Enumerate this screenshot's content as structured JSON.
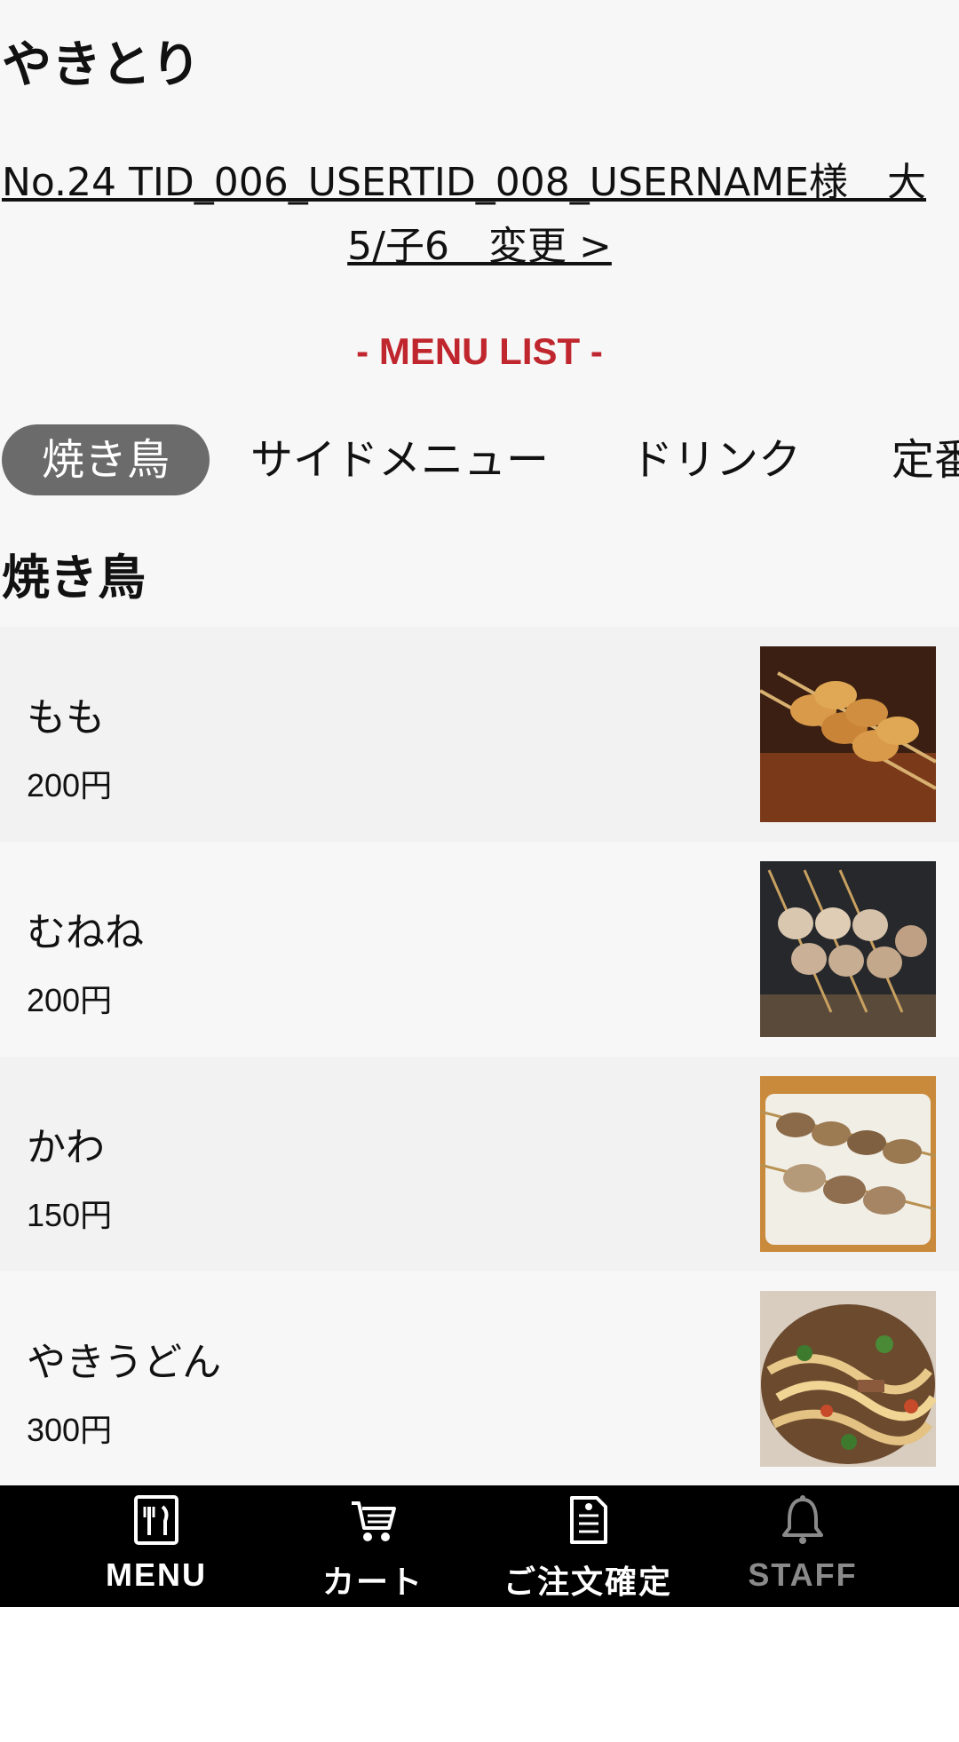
{
  "shop": {
    "title": "やきとり"
  },
  "customer": {
    "line1": "No.24 TID_006_USERTID_008_USERNAME様　大",
    "line2": "5/子6　変更 >"
  },
  "menu_heading": "- MENU LIST -",
  "tabs": [
    {
      "label": "焼き鳥",
      "active": true
    },
    {
      "label": "サイドメニュー",
      "active": false
    },
    {
      "label": "ドリンク",
      "active": false
    },
    {
      "label": "定番",
      "active": false
    }
  ],
  "section": {
    "title": "焼き鳥"
  },
  "items": [
    {
      "name": "もも",
      "price": "200円",
      "image": "yakitori-momo-photo"
    },
    {
      "name": "むねね",
      "price": "200円",
      "image": "yakitori-mune-photo"
    },
    {
      "name": "かわ",
      "price": "150円",
      "image": "yakitori-kawa-photo"
    },
    {
      "name": "やきうどん",
      "price": "300円",
      "image": "yaki-udon-photo"
    }
  ],
  "nav": [
    {
      "label": "MENU",
      "icon": "menu-fork-knife-icon"
    },
    {
      "label": "カート",
      "icon": "cart-icon"
    },
    {
      "label": "ご注文確定",
      "icon": "order-receipt-icon"
    },
    {
      "label": "STAFF",
      "icon": "bell-icon"
    }
  ]
}
